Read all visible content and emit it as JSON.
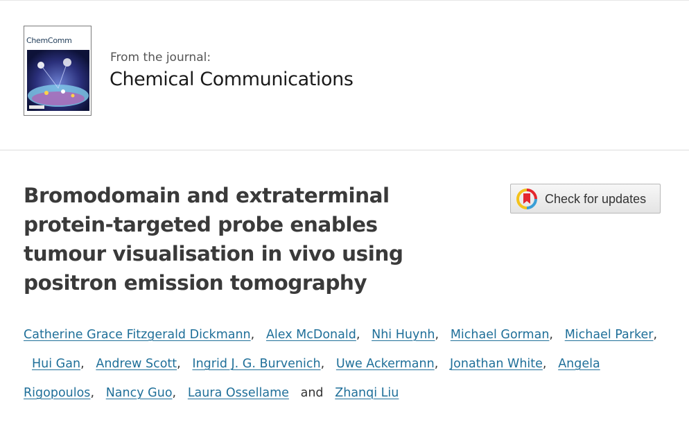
{
  "journal": {
    "cover_title": "ChemComm",
    "from_label": "From the journal:",
    "name": "Chemical Communications"
  },
  "article": {
    "title_lines": [
      "Bromodomain and extraterminal",
      "protein-targeted probe enables",
      "tumour visualisation in vivo using",
      "positron emission tomography"
    ]
  },
  "check_updates": {
    "label": "Check for updates",
    "colors": {
      "ring_red": "#e4272e",
      "ring_yellow": "#f4c21b",
      "ring_blue": "#3a9fd6",
      "bookmark": "#e4272e"
    }
  },
  "authors": {
    "names": [
      "Catherine Grace Fitzgerald Dickmann",
      "Alex McDonald",
      "Nhi Huynh",
      "Michael Gorman",
      "Michael Parker",
      "Hui Gan",
      "Andrew Scott",
      "Ingrid J. G. Burvenich",
      "Uwe Ackermann",
      "Jonathan White",
      "Angela",
      "Rigopoulos",
      "Nancy Guo",
      "Laura Ossellame",
      "Zhanqi Liu"
    ],
    "separator": ",",
    "conjunction": "and",
    "link_color": "#1f6f99"
  }
}
